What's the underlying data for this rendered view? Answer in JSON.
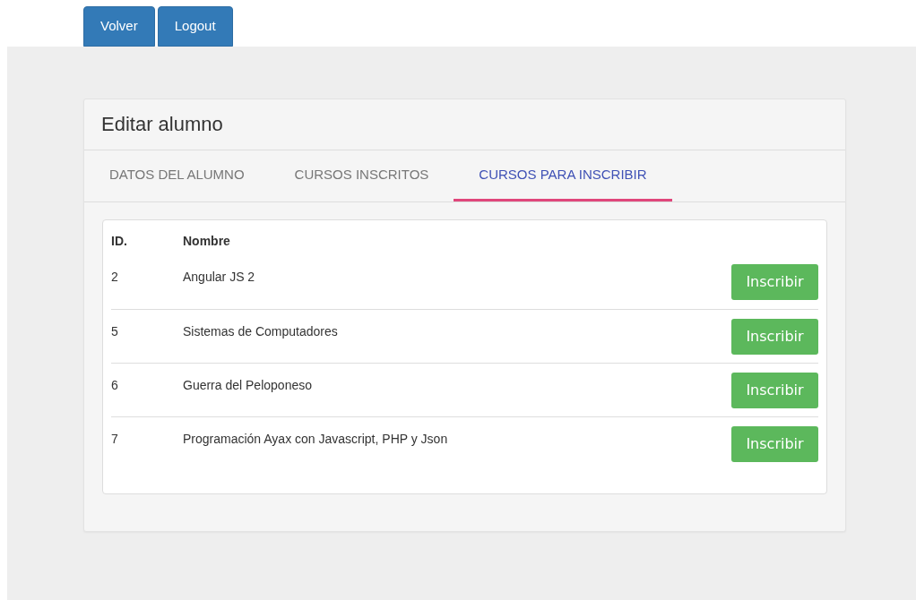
{
  "top_buttons": [
    "Volver",
    "Logout"
  ],
  "card": {
    "title": "Editar alumno"
  },
  "tabs": [
    {
      "label": "DATOS DEL ALUMNO",
      "selected": false
    },
    {
      "label": "CURSOS INSCRITOS",
      "selected": false
    },
    {
      "label": "CURSOS PARA INSCRIBIR",
      "selected": true
    }
  ],
  "table": {
    "columns": [
      "ID.",
      "Nombre"
    ],
    "rows": [
      {
        "id": "2",
        "nombre": "Angular JS 2",
        "action": "Inscribir"
      },
      {
        "id": "5",
        "nombre": "Sistemas de Computadores",
        "action": "Inscribir"
      },
      {
        "id": "6",
        "nombre": "Guerra del Peloponeso",
        "action": "Inscribir"
      },
      {
        "id": "7",
        "nombre": "Programación Ayax con Javascript, PHP y Json",
        "action": "Inscribir"
      }
    ]
  }
}
